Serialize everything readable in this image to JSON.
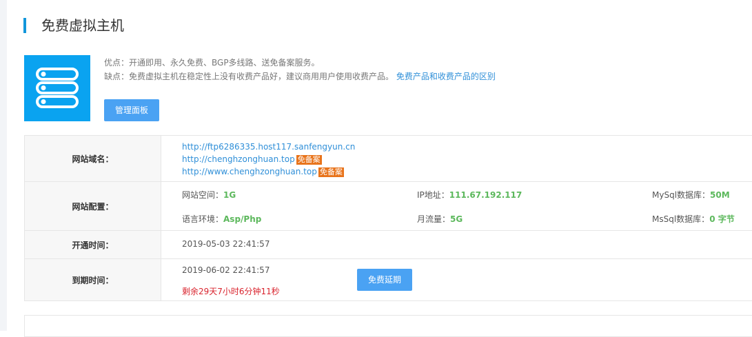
{
  "page_title": "免费虚拟主机",
  "product_icon": "server-stack-icon",
  "colors": {
    "accent": "#1296db",
    "button": "#4aa2f3",
    "badge": "#e8731a",
    "value_green": "#5cb85c",
    "warning_red": "#d9232d",
    "link": "#2f8fd8"
  },
  "desc": {
    "pros": "优点：开通即用、永久免费、BGP多线路、送免备案服务。",
    "cons": "缺点：免费虚拟主机在稳定性上没有收费产品好，建议商用用户使用收费产品。",
    "compare_link": "免费产品和收费产品的区别"
  },
  "panel_button": "管理面板",
  "rows": {
    "domains": {
      "label": "网站域名：",
      "items": [
        {
          "url": "http://ftp6286335.host117.sanfengyun.cn",
          "badge": ""
        },
        {
          "url": "http://chenghzonghuan.top",
          "badge": "免备案"
        },
        {
          "url": "http://www.chenghzonghuan.top",
          "badge": "免备案"
        }
      ]
    },
    "config": {
      "label": "网站配置：",
      "space_label": "网站空间：",
      "space_value": "1G",
      "ip_label": "IP地址：",
      "ip_value": "111.67.192.117",
      "mysql_label": "MySql数据库：",
      "mysql_value": "50M",
      "lang_label": "语言环境：",
      "lang_value": "Asp/Php",
      "traffic_label": "月流量：",
      "traffic_value": "5G",
      "mssql_label": "MsSql数据库：",
      "mssql_value": "0 字节"
    },
    "open_time": {
      "label": "开通时间：",
      "value": "2019-05-03 22:41:57"
    },
    "expire_time": {
      "label": "到期时间：",
      "value": "2019-06-02 22:41:57",
      "remaining": "剩余29天7小时6分钟11秒",
      "extend_button": "免费延期"
    }
  }
}
